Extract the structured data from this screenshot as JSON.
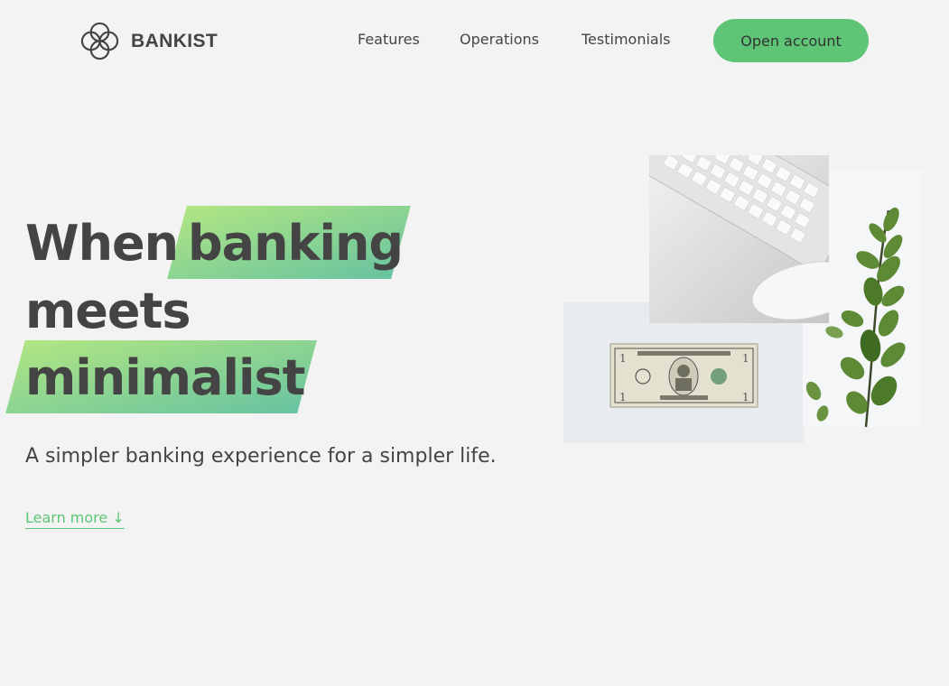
{
  "nav": {
    "logo_text": "BANKIST",
    "links": [
      {
        "label": "Features"
      },
      {
        "label": "Operations"
      },
      {
        "label": "Testimonials"
      }
    ],
    "cta_label": "Open account"
  },
  "hero": {
    "title_word_1": "When",
    "title_word_2": "banking",
    "title_word_3": "meets",
    "title_word_4": "minimalist",
    "subtitle": "A simpler banking experience for a simpler life.",
    "learn_more_label": "Learn more ↓"
  },
  "colors": {
    "brand": "#5ec576",
    "highlight_start": "#9be15d",
    "highlight_end": "#39b385",
    "background": "#f3f3f3",
    "text": "#444444"
  },
  "icons": [
    "bankist-logo-icon"
  ]
}
